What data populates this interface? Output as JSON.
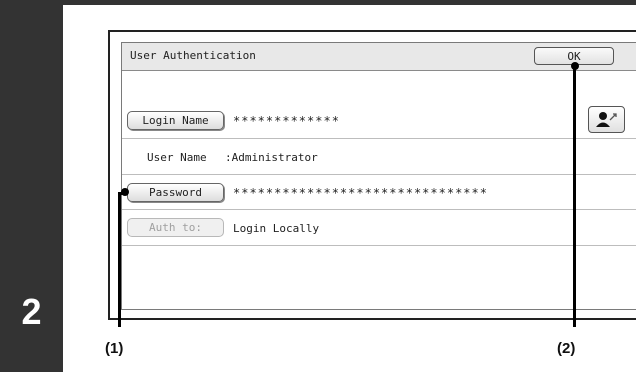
{
  "step": {
    "number": "2"
  },
  "dialog": {
    "title": "User Authentication",
    "ok_label": "OK",
    "rows": [
      {
        "button": "Login Name",
        "value": "*************"
      },
      {
        "label": "User Name",
        "value": ":Administrator"
      },
      {
        "button": "Password",
        "value": "*******************************"
      },
      {
        "button": "Auth to:",
        "value": "Login Locally",
        "button_disabled": true
      }
    ],
    "user_select_icon": "user-select-icon"
  },
  "callouts": {
    "left": "(1)",
    "right": "(2)"
  }
}
